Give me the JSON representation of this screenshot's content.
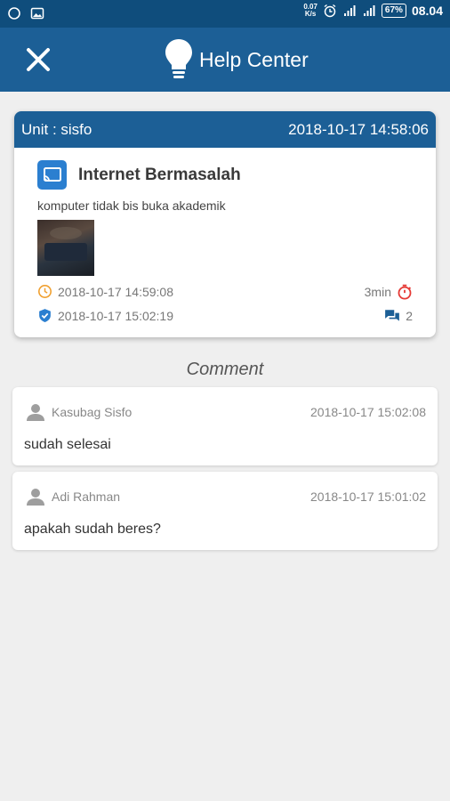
{
  "status_bar": {
    "net_speed_value": "0.07",
    "net_speed_unit": "K/s",
    "battery": "67",
    "time": "08.04"
  },
  "app_bar": {
    "title": "Help Center",
    "close_icon": "close-icon",
    "logo_icon": "lightbulb-icon"
  },
  "ticket": {
    "unit": "Unit : sisfo",
    "created": "2018-10-17 14:58:06",
    "title": "Internet Bermasalah",
    "description": "komputer tidak bis buka akademik",
    "responded_at": "2018-10-17 14:59:08",
    "response_time": "3min",
    "resolved_at": "2018-10-17 15:02:19",
    "comment_count": "2"
  },
  "comments_section": {
    "heading": "Comment",
    "items": [
      {
        "user": "Kasubag Sisfo",
        "time": "2018-10-17 15:02:08",
        "text": "sudah selesai"
      },
      {
        "user": "Adi Rahman",
        "time": "2018-10-17 15:01:02",
        "text": "apakah sudah beres?"
      }
    ]
  },
  "colors": {
    "status_bar": "#0f4d7c",
    "app_bar": "#1c5f96",
    "accent_blue": "#2b7fd0",
    "clock_orange": "#f0a030",
    "timer_red": "#e53935"
  }
}
